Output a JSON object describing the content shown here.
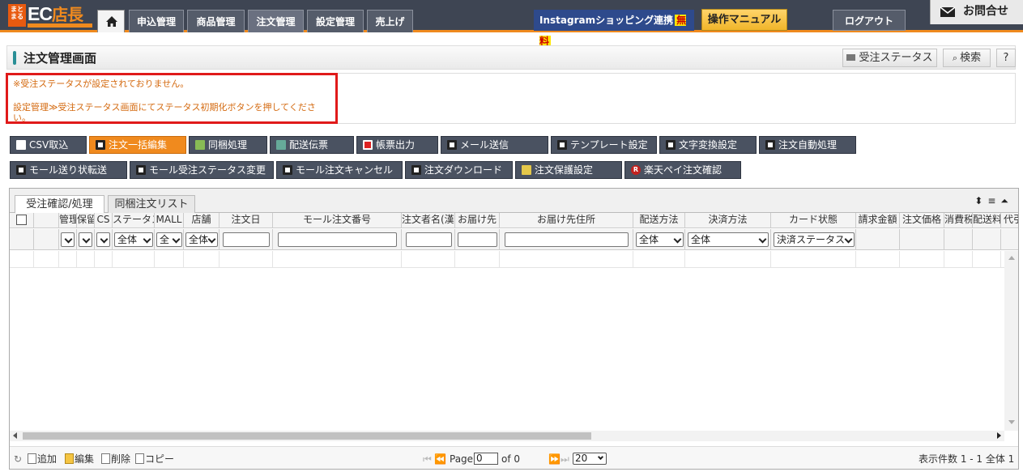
{
  "header": {
    "logo_mark": "まとまる",
    "logo_text": "EC",
    "logo_text2": "店長",
    "nav": [
      "申込管理",
      "商品管理",
      "注文管理",
      "設定管理",
      "売上げ"
    ],
    "instagram_label": "Instagramショッピング連携",
    "instagram_badge": "無料",
    "manual_label": "操作マニュアル",
    "logout_label": "ログアウト",
    "inquiry_label": "お問合せ"
  },
  "page": {
    "title": "注文管理画面",
    "status_button": "受注ステータス",
    "search_button": "検索",
    "help_button": "?"
  },
  "alert": {
    "line1": "※受注ステータスが設定されておりません。",
    "line2": "設定管理≫受注ステータス画面にてステータス初期化ボタンを押してください。"
  },
  "actions_row1": [
    "CSV取込",
    "注文一括編集",
    "同梱処理",
    "配送伝票",
    "帳票出力",
    "メール送信",
    "テンプレート設定",
    "文字変換設定",
    "注文自動処理"
  ],
  "actions_row2": [
    "モール送り状転送",
    "モール受注ステータス変更",
    "モール注文キャンセル",
    "注文ダウンロード",
    "注文保護設定",
    "楽天ペイ注文確認"
  ],
  "grid": {
    "tabs": [
      "受注確認/処理",
      "同梱注文リスト"
    ],
    "columns": [
      "",
      "",
      "管理",
      "保留",
      "CS",
      "ステータス",
      "MALL",
      "店舗",
      "注文日",
      "モール注文番号",
      "注文者名(漢字)",
      "お届け先",
      "お届け先住所",
      "配送方法",
      "決済方法",
      "カード状態",
      "請求金額",
      "注文価格",
      "消費税",
      "配送料",
      "代引"
    ],
    "filters": {
      "status": "全体",
      "mall": "全",
      "shop": "全体",
      "delivery": "全体",
      "payment": "全体",
      "card": "決済ステータス"
    },
    "pager": {
      "add": "追加",
      "edit": "編集",
      "delete": "削除",
      "copy": "コピー",
      "page_label": "Page",
      "page_value": "0",
      "of_label": "of 0",
      "per_page": "20",
      "summary": "表示件数 1 - 1 全体 1"
    }
  }
}
